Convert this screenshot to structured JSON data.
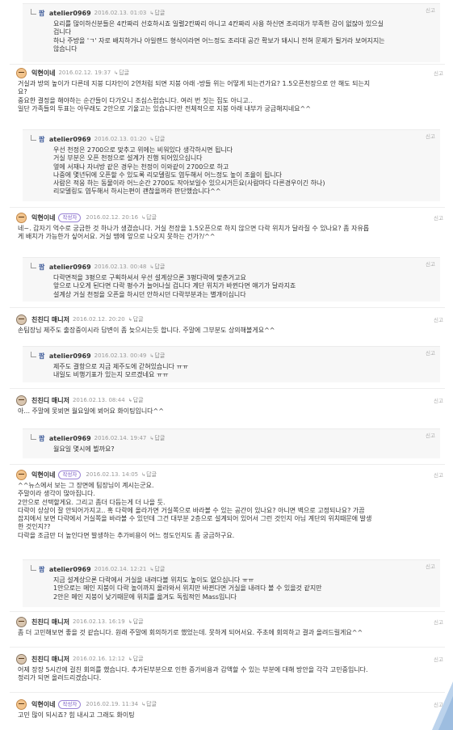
{
  "ui": {
    "reply_label": "답글",
    "report_label": "신고",
    "author_badge": "작성자"
  },
  "comments": [
    {
      "author": "atelier0969",
      "date": "2016.02.13. 01:03",
      "text": "요리를 많이하신분들은 4칸짜리 선호하시죠 일렬2칸짜리 아니고 4칸짜리 사용 하신면 조리대가 부족한 감이 없잖아 있으실\n겁니다\n하나 주방을 'ㄱ' 자로 배치하거나 아일랜드 형식이라면 어느정도 조리대 공간 확보가 돼시니 전혀 문제가 될거라 보여지지는\n않습니다"
    },
    {
      "author": "익현이네",
      "date": "2016.02.12. 19:37",
      "text": "거실과 방의 높이가 다른데 지붕 디자인이 2연처럼 되면 지붕 아래 -방들 위는 어떻게 되는건가요? 1.5오픈천장으로 안 해도 되는지\n요?\n중요한 결정을 해야하는 순간들이 다가오니 조심스럽습니다. 여러 번 짓는 집도 아니고..\n일단 가족들의 투표는 아무래도 2안으로 기울고는 있습니다만 전체적으로 지붕 아래 내부가 궁금해지네요^^"
    },
    {
      "author": "atelier0969",
      "date": "2016.02.13. 01:20",
      "text": "우선 천정은 2700으로 맞추고 위에는 비워있다 생각하시면 됩니다\n거실 부분은 오픈 천정으로 설계가 진행 되어있으십니다\n옆에 서재나 자녀방 같은 경우는 천정이 이와같이 2700으로 하고\n나중에 몇년뒤에 오픈할 수 있도록 리모델링도 염두해서 어느정도 높이 조율이 됩니다\n사람은 적응 하는 동물이라 어느순간 2700도 작아보일수 있으시거든요(사람마다 다른경우이긴 하나)\n리모델링도 염두해서 하시는편이 괜찮을꺼라 판단했습니다^^"
    },
    {
      "author": "익현이네",
      "date": "2016.02.12. 20:16",
      "text": "네~. 갑자기 억수로 궁금한 것 하나가 생겼습니다. 거실 천장을 1.5오픈으로 하지 않으면 다락 위치가 달라질 수 있나요? 좀 자유롭\n게 배치가 가능한가 싶어서요. 거실 땜에 앞으로 나오지 못하는 건가?/^^"
    },
    {
      "author": "atelier0969",
      "date": "2016.02.13. 00:48",
      "text": "다락면적을 3평으로 구획하셔서 우선 설계상으론 3평다락에 맞춘거고요\n앞으로 나오게 된다면 다락 평수가 늘어나실 겁니다 계단 위치가 바뀐다면 얘기가 달라지죠\n설계상 거실 천정을 오픈을 하시던 안하시던 다락부분과는 별개이십니다"
    },
    {
      "author": "친친디 매니저",
      "date": "2016.02.12. 20:20",
      "text": "손팀장님 제주도 출장중이시라 답변이 좀 늦으시는듯 합니다. 주말에 그부분도 상의해볼게요^^"
    },
    {
      "author": "atelier0969",
      "date": "2016.02.13. 00:49",
      "text": "제주도 결항으로 지금 제주도에 갇혀있습니다 ㅠㅠ\n내일도 비행기표가 있는지 모르겠네요 ㅠㅠ"
    },
    {
      "author": "친친디 매니저",
      "date": "2016.02.13. 08:44",
      "text": "아... 주말에 못뵈면 월요일에 뵈어요 화이팅입니다^^"
    },
    {
      "author": "atelier0969",
      "date": "2016.02.14. 19:47",
      "text": "월요일 몇시에 뵐까요?"
    },
    {
      "author": "익현이네",
      "date": "2016.02.13. 14:05",
      "text": "^^뉴스에서 보는 그 장면에 팀장님이 계시는군요.\n주말이라 생각이 많아집니다.\n2안으로 선택할게요. 그리고 좀더 다듬는게 더 나을 듯.\n다락이 상상이 잘 안되어가지고.. 혹 다락에 올라가면 거실쪽으로 바라볼 수 있는 공간이 있나요? 아니면 벽으로 고정되나요? 가끔\n잡지에서 보면 다락에서 거실쪽을 바라볼 수 있던데 그건 대부분 2층으로 설계되어 있어서 그런 것인지 아님 계단의 위치때문에 발생\n한 것인지??\n다락을 조금만 더 높인다면 발생하는 추가비용이 어느 정도인지도 좀 궁금하구요."
    },
    {
      "author": "atelier0969",
      "date": "2016.02.14. 12:21",
      "text": "지금 설계상으론 다락에서 거실을 내려다볼 위치도 높이도 없으십니다 ㅠㅠ\n1안으로는 메인 지붕이 다락 높이까지 올라와서 위치만 바뀐다면 거실을 내려다 볼 수 있을것 같지만\n2안은 메인 지붕이 낮기때문에 위치를 옮겨도 독립적인 Mass입니다"
    },
    {
      "author": "친친디 매니저",
      "date": "2016.02.13. 16:19",
      "text": "좀 더 고민해보면 좋을 것 같습니다. 원래 주말에 회의하기로 했었는데. 못하게 되어서요. 주초에 회의하고 결과 올려드릴게요^^"
    },
    {
      "author": "친친디 매니저",
      "date": "2016.02.16. 12:12",
      "text": "어제 장장 5시간에 걸친 회의를 했습니다. 추가된부분으로 인한 증가비용과 감액할 수 있는 부분에 대해 방안을 각각 고민중입니다.\n정리가 되면 올려드리겠습니다."
    },
    {
      "author": "익현이네",
      "date": "2016.02.19. 11:34",
      "text": "고민 많이 되시죠? 힘 내시고 그래도 화이팅"
    }
  ]
}
